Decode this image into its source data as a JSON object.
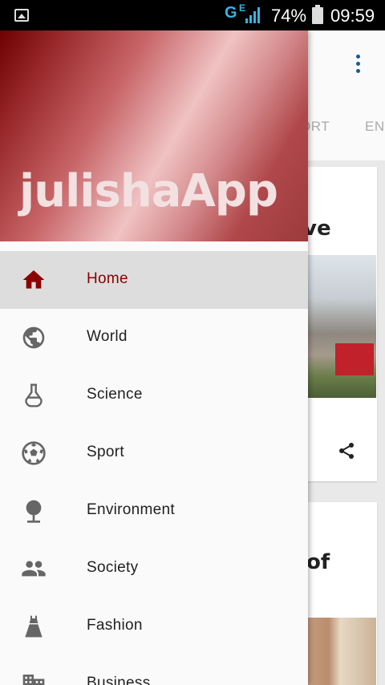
{
  "status_bar": {
    "network": "G",
    "network_sub": "E",
    "battery": "74%",
    "time": "09:59"
  },
  "background": {
    "tabs": [
      "ORT",
      "EN"
    ],
    "card1_headline_tail": "ve",
    "card2_headline_tail": "of"
  },
  "drawer": {
    "title": "julishaApp",
    "items": [
      {
        "label": "Home",
        "icon": "home-icon",
        "active": true
      },
      {
        "label": "World",
        "icon": "globe-icon"
      },
      {
        "label": "Science",
        "icon": "flask-icon"
      },
      {
        "label": "Sport",
        "icon": "soccer-ball-icon"
      },
      {
        "label": "Environment",
        "icon": "tree-icon"
      },
      {
        "label": "Society",
        "icon": "people-icon"
      },
      {
        "label": "Fashion",
        "icon": "dress-icon"
      },
      {
        "label": "Business",
        "icon": "building-icon"
      }
    ]
  },
  "colors": {
    "accent": "#8b0000",
    "active_bg": "#dddddd",
    "icon": "#666666"
  }
}
